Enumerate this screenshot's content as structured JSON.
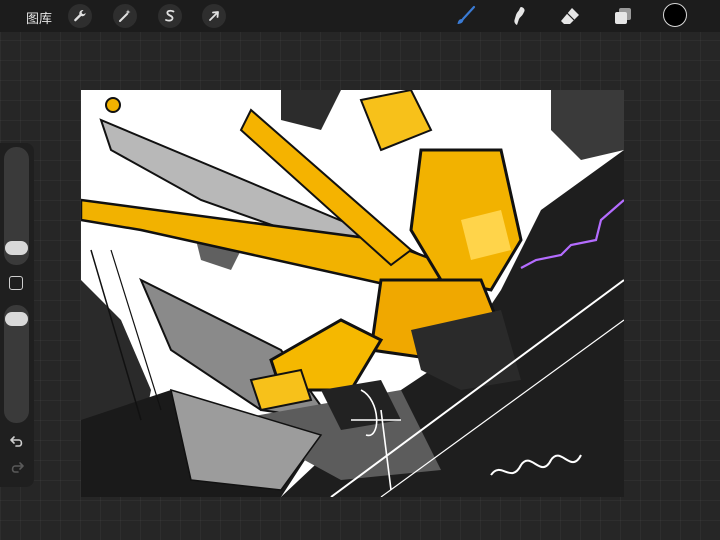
{
  "topbar": {
    "gallery_label": "图库",
    "tools_left": [
      "wrench-icon",
      "magic-wand-icon",
      "selection-s-icon",
      "arrow-transform-icon"
    ],
    "tools_right": [
      "brush-icon",
      "smudge-icon",
      "eraser-icon",
      "layers-icon"
    ],
    "active_tool": "brush",
    "current_color": "#000000",
    "accent": "#3a7bd5"
  },
  "sidebar": {
    "brush_size": 0.08,
    "brush_opacity": 0.95,
    "icons": [
      "modify-square-icon",
      "undo-icon",
      "redo-icon"
    ]
  },
  "canvas": {
    "description_colors": {
      "gold": "#f2b200",
      "dark": "#1e1e1e",
      "grey": "#8a8a8a",
      "purple": "#b46cff"
    }
  }
}
